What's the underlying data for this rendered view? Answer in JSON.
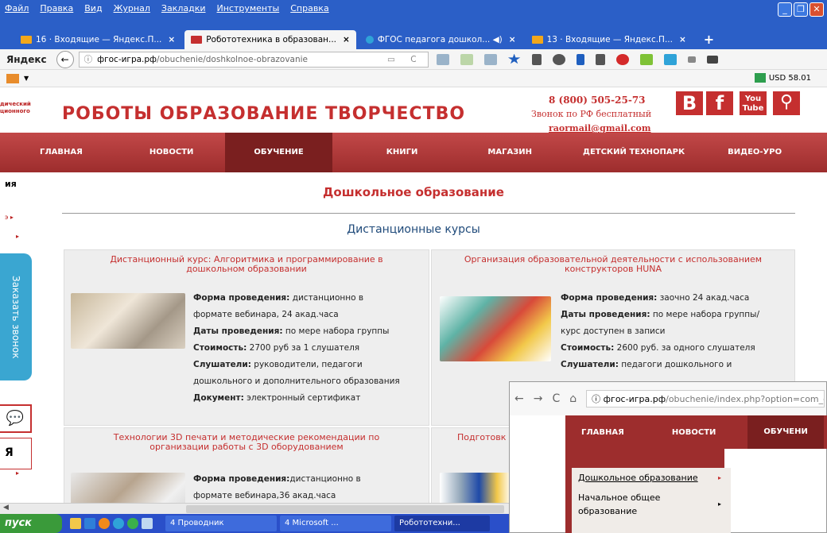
{
  "menubar": {
    "items": [
      "Файл",
      "Правка",
      "Вид",
      "Журнал",
      "Закладки",
      "Инструменты",
      "Справка"
    ]
  },
  "tabs": [
    {
      "label": "16 · Входящие — Яндекс.П...",
      "close": "×",
      "color": "#f2a71b"
    },
    {
      "label": "Робототехника в образован...",
      "close": "×",
      "color": "#c52f2f"
    },
    {
      "label": "ФГОС педагога дошкол... ◀)",
      "close": "×",
      "color": "#2fa3d8"
    },
    {
      "label": "13 · Входящие — Яндекс.П...",
      "close": "×",
      "color": "#f2a71b"
    }
  ],
  "tab_plus": "+",
  "navbar": {
    "brand": "Яндекс",
    "back": "←",
    "info": "ⓘ",
    "url_host": "фгос-игра.рф",
    "url_path": "/obuchenie/doshkolnoe-obrazovanie",
    "url_icons": "▭ C"
  },
  "bmbar": {
    "usd": "USD 58.01"
  },
  "site": {
    "logo_left": "дический ционного",
    "title": "РОБОТЫ ОБРАЗОВАНИЕ ТВОРЧЕСТВО",
    "phone": "8 (800) 505-25-73",
    "phone_sub": "Звонок по РФ бесплатный",
    "email": "raormail@gmail.com",
    "social": {
      "b": "B",
      "f": "f",
      "yt": "You Tube",
      "search": "⚲"
    },
    "nav": [
      "ГЛАВНАЯ",
      "НОВОСТИ",
      "ОБУЧЕНИЕ",
      "КНИГИ",
      "МАГАЗИН",
      "ДЕТСКИЙ ТЕХНОПАРК",
      "ВИДЕО-УРО"
    ],
    "nav_active_index": 2,
    "left_label": "ия",
    "callme": "Заказать звонок",
    "ya": "Я",
    "page_heading": "Дошкольное образование",
    "sub_heading": "Дистанционные курсы"
  },
  "cards": [
    {
      "title": "Дистанционный курс: Алгоритмика и программирование в дошкольном образовании",
      "rows": [
        {
          "k": "Форма проведения:",
          "v": " дистанционно в"
        },
        {
          "k": "",
          "v": "формате вебинара, 24 акад.часа"
        },
        {
          "k": "Даты проведения:",
          "v": " по мере набора группы"
        },
        {
          "k": "Стоимость:",
          "v": " 2700 руб за 1 слушателя"
        },
        {
          "k": "Слушатели:",
          "v": " руководители, педагоги"
        },
        {
          "k": "",
          "v": "дошкольного и дополнительного образования"
        },
        {
          "k": "Документ:",
          "v": " электронный сертификат"
        }
      ]
    },
    {
      "title": "Организация образовательной деятельности с использованием конструкторов HUNA",
      "rows": [
        {
          "k": "Форма проведения:",
          "v": " заочно 24 акад.часа"
        },
        {
          "k": "Даты проведения:",
          "v": " по мере набора группы/"
        },
        {
          "k": "",
          "v": "курс доступен в записи"
        },
        {
          "k": "Стоимость:",
          "v": " 2600 руб. за одного слушателя"
        },
        {
          "k": "Слушатели:",
          "v": " педагоги дошкольного и"
        }
      ]
    },
    {
      "title": "Технологии 3D печати и методические рекомендации по организации работы с 3D оборудованием",
      "rows": [
        {
          "k": "Форма проведения:",
          "v": "дистанционно в"
        },
        {
          "k": "",
          "v": "формате вебинара,36 акад.часа"
        }
      ]
    },
    {
      "title": "Подготовк «",
      "rows": []
    }
  ],
  "popup": {
    "nav": [
      "←",
      "→",
      "C",
      "⌂"
    ],
    "url_host": "ⓘ фгос-игра.рф",
    "url_path": "/obuchenie/index.php?option=com_c",
    "menu": [
      "ГЛАВНАЯ",
      "НОВОСТИ",
      "ОБУЧЕНИ"
    ],
    "dropdown": [
      {
        "label": "Дошкольное образование",
        "arrow": "▸"
      },
      {
        "label": "Начальное общее",
        "arrow": "▸"
      },
      {
        "label": "образование",
        "arrow": ""
      }
    ]
  },
  "taskbar": {
    "start": "пуск",
    "buttons": [
      "4 Проводник",
      "4 Microsoft ...",
      "Робототехни..."
    ]
  },
  "window_controls": [
    "_",
    "❐",
    "✕"
  ]
}
